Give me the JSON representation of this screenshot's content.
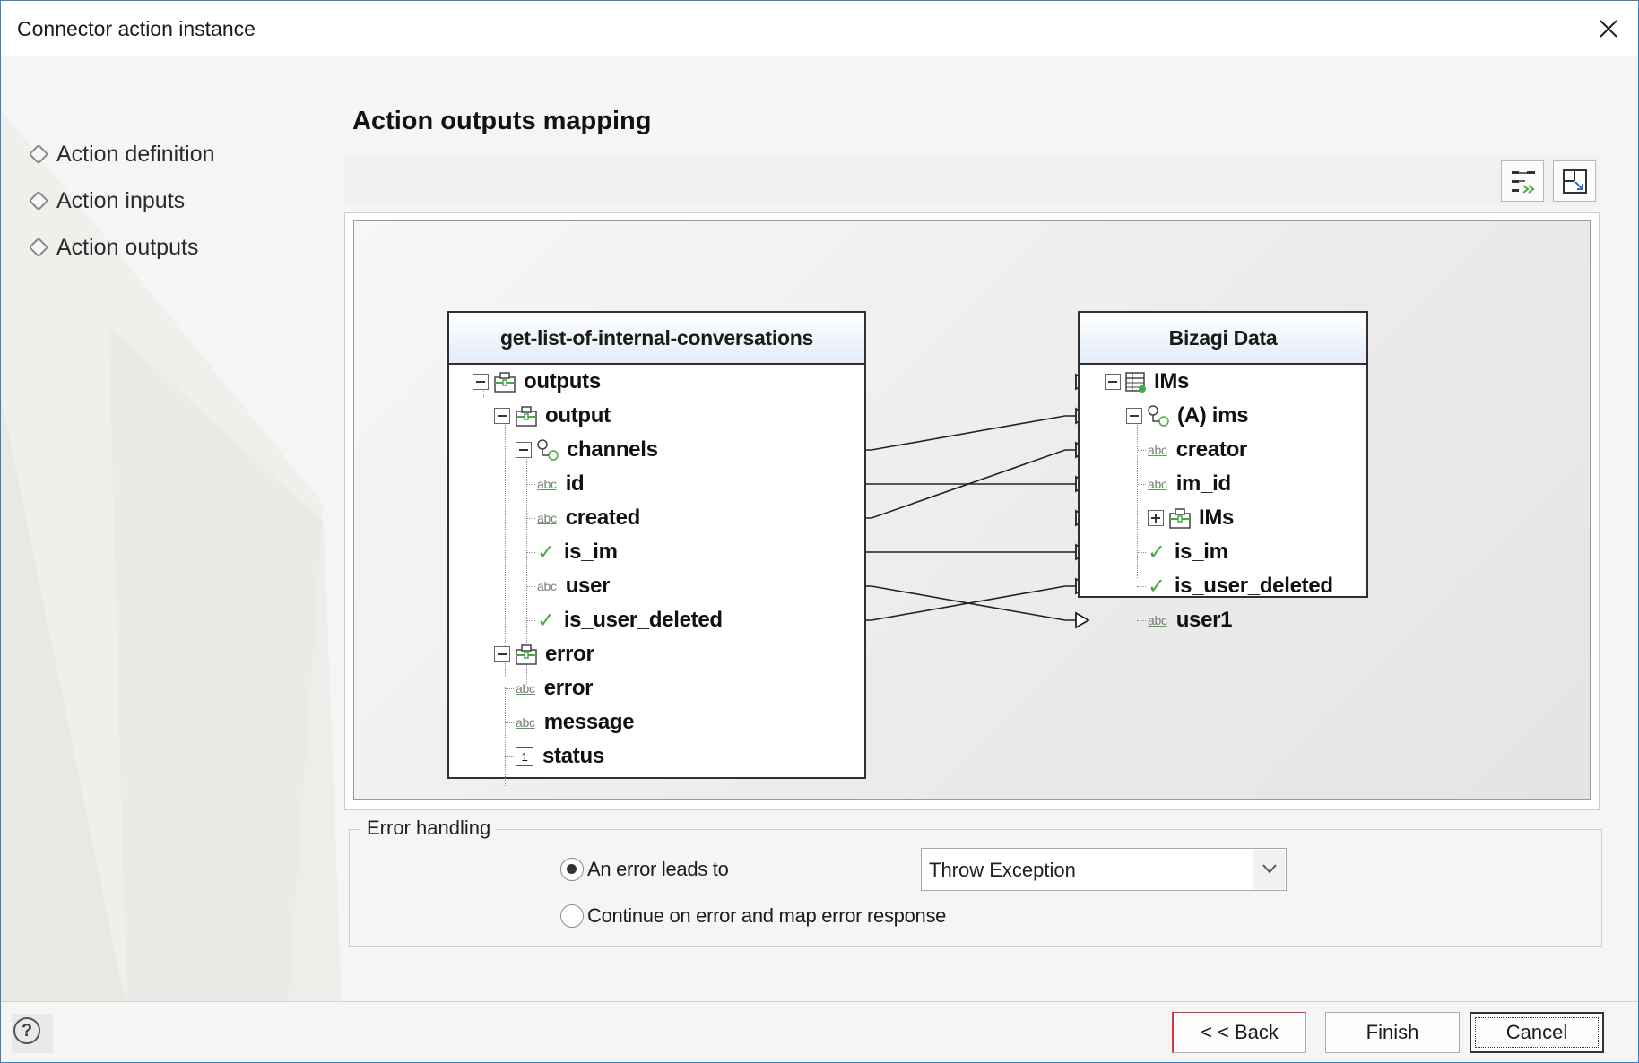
{
  "window": {
    "title": "Connector action instance"
  },
  "steps": [
    {
      "label": "Action definition"
    },
    {
      "label": "Action inputs"
    },
    {
      "label": "Action outputs"
    }
  ],
  "section": {
    "title": "Action outputs mapping"
  },
  "source": {
    "title": "get-list-of-internal-conversations",
    "rows": [
      {
        "label": "outputs",
        "icon": "object-icon"
      },
      {
        "label": "output",
        "icon": "object-icon"
      },
      {
        "label": "channels",
        "icon": "collection-icon"
      },
      {
        "label": "id",
        "icon": "string-icon"
      },
      {
        "label": "created",
        "icon": "string-icon"
      },
      {
        "label": "is_im",
        "icon": "boolean-icon"
      },
      {
        "label": "user",
        "icon": "string-icon"
      },
      {
        "label": "is_user_deleted",
        "icon": "boolean-icon"
      },
      {
        "label": "error",
        "icon": "object-icon"
      },
      {
        "label": "error",
        "icon": "string-icon"
      },
      {
        "label": "message",
        "icon": "string-icon"
      },
      {
        "label": "status",
        "icon": "number-icon"
      }
    ]
  },
  "target": {
    "title": "Bizagi Data",
    "rows": [
      {
        "label": "IMs",
        "icon": "entity-icon"
      },
      {
        "label": "(A) ims",
        "icon": "collection-icon"
      },
      {
        "label": "creator",
        "icon": "string-icon"
      },
      {
        "label": "im_id",
        "icon": "string-icon"
      },
      {
        "label": "IMs",
        "icon": "object-icon"
      },
      {
        "label": "is_im",
        "icon": "boolean-icon"
      },
      {
        "label": "is_user_deleted",
        "icon": "boolean-icon"
      },
      {
        "label": "user1",
        "icon": "string-icon"
      }
    ]
  },
  "mappings": [
    {
      "from": "channels",
      "to": "(A) ims"
    },
    {
      "from": "id",
      "to": "im_id"
    },
    {
      "from": "created",
      "to": "creator"
    },
    {
      "from": "is_im",
      "to": "is_im"
    },
    {
      "from": "user",
      "to": "user1"
    },
    {
      "from": "is_user_deleted",
      "to": "is_user_deleted"
    }
  ],
  "icons": {
    "abc": "abc",
    "check": "✓",
    "number": "1"
  },
  "error_handling": {
    "legend": "Error handling",
    "option_error_leads": "An error leads to",
    "option_continue": "Continue on error and map error response",
    "selected_option": "An error leads to",
    "select_value": "Throw Exception"
  },
  "footer": {
    "help": "?",
    "back": "< < Back",
    "finish": "Finish",
    "cancel": "Cancel"
  },
  "colors": {
    "accent_border": "#3f7fbf",
    "check_green": "#4aa844",
    "back_focus": "#d23a3a"
  }
}
